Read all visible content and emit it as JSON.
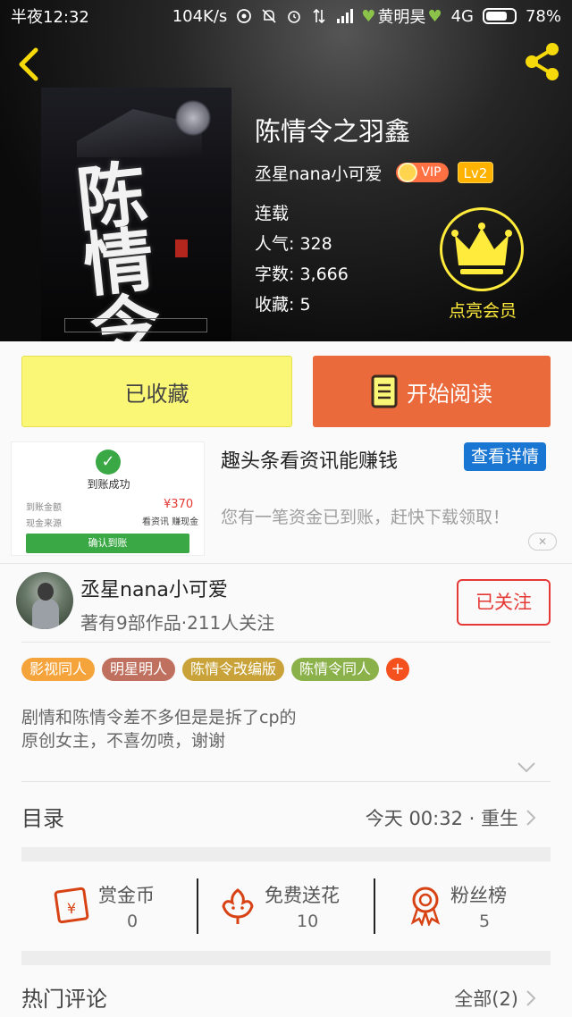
{
  "status_bar": {
    "time": "半夜12:32",
    "speed": "104K/s",
    "carrier": "黄明昊",
    "network": "4G",
    "battery": "78%",
    "battery_level": 0.78
  },
  "book": {
    "title": "陈情令之羽鑫",
    "author": "丞星nana小可爱",
    "vip": "VIP",
    "level": "Lv2",
    "status": "连载",
    "popularity": "人气: 328",
    "word_count": "字数: 3,666",
    "favorites": "收藏: 5",
    "member_label": "点亮会员"
  },
  "actions": {
    "collected": "已收藏",
    "start_reading": "开始阅读"
  },
  "ad": {
    "title": "趣头条看资讯能赚钱",
    "button": "查看详情",
    "description": "您有一笔资金已到账，赶快下载领取！",
    "image_status": "到账成功",
    "image_amount": "¥370",
    "image_amount_label": "到账金额",
    "image_source_label": "现金来源",
    "image_source_value": "看资讯  赚现金",
    "image_confirm": "确认到账",
    "close": "✕"
  },
  "author": {
    "name": "丞星nana小可爱",
    "stats": "著有9部作品·211人关注",
    "follow": "已关注"
  },
  "tags": [
    {
      "label": "影视同人",
      "color": "#f5a33b"
    },
    {
      "label": "明星明人",
      "color": "#c0705e"
    },
    {
      "label": "陈情令改编版",
      "color": "#c9a33a"
    },
    {
      "label": "陈情令同人",
      "color": "#8bb24a"
    }
  ],
  "tag_add": "+",
  "synopsis": {
    "line1": "剧情和陈情令差不多但是是拆了cp的",
    "line2": "原创女主，不喜勿喷，谢谢"
  },
  "catalog": {
    "label": "目录",
    "latest": "今天 00:32 · 重生"
  },
  "stats": [
    {
      "label": "赏金币",
      "value": "0",
      "icon": "red-envelope-icon"
    },
    {
      "label": "免费送花",
      "value": "10",
      "icon": "flower-icon"
    },
    {
      "label": "粉丝榜",
      "value": "5",
      "icon": "award-ribbon-icon"
    }
  ],
  "comments": {
    "label": "热门评论",
    "all": "全部(2)"
  },
  "colors": {
    "collected_bg": "#fbf776",
    "read_bg": "#ea6a3c",
    "accent_red": "#e53935",
    "member_gold": "#ffeb3b",
    "ad_button": "#1976d2"
  }
}
